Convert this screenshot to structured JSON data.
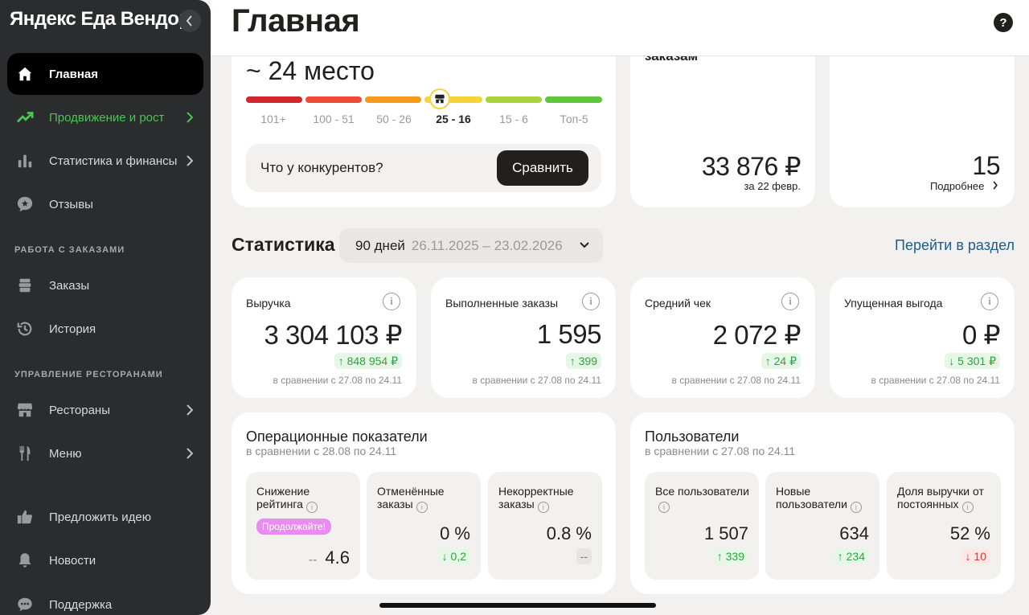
{
  "app": {
    "brand": "Яндекс Еда Вендор"
  },
  "header": {
    "title": "Главная",
    "help": "?"
  },
  "sidebar": {
    "items": [
      {
        "label": "Главная",
        "icon": "home-icon"
      },
      {
        "label": "Продвижение и рост",
        "icon": "trend-icon"
      },
      {
        "label": "Статистика и финансы",
        "icon": "bar-chart-icon"
      },
      {
        "label": "Отзывы",
        "icon": "review-icon"
      }
    ],
    "section_orders": "РАБОТА С ЗАКАЗАМИ",
    "orders_items": [
      {
        "label": "Заказы",
        "icon": "orders-icon"
      },
      {
        "label": "История",
        "icon": "history-icon"
      }
    ],
    "section_restaurants": "УПРАВЛЕНИЕ РЕСТОРАНАМИ",
    "restaurant_items": [
      {
        "label": "Рестораны",
        "icon": "store-icon"
      },
      {
        "label": "Меню",
        "icon": "fork-knife-icon"
      }
    ],
    "bottom_items": [
      {
        "label": "Предложить идею",
        "icon": "thumbs-up-icon"
      },
      {
        "label": "Новости",
        "icon": "bell-icon"
      },
      {
        "label": "Поддержка",
        "icon": "chat-icon"
      }
    ]
  },
  "rating": {
    "place": "~ 24 место",
    "scale": [
      "101+",
      "100 - 51",
      "50 - 26",
      "25 - 16",
      "15 - 6",
      "Топ-5"
    ],
    "current_index": 3,
    "colors": [
      "#d1262d",
      "#ef4a35",
      "#f59a1b",
      "#f5d43a",
      "#a9d33b",
      "#5ec63a"
    ],
    "compare_question": "Что у конкурентов?",
    "compare_button": "Сравнить"
  },
  "orders_card": {
    "title_fragment": "заказам",
    "value": "33 876 ₽",
    "note": "за 22 февр."
  },
  "count_card": {
    "value": "15",
    "link": "Подробнее"
  },
  "stats": {
    "title": "Статистика",
    "period_label": "90 дней",
    "period_range": "26.11.2025 – 23.02.2026",
    "link": "Перейти в раздел",
    "metrics": [
      {
        "title": "Выручка",
        "value": "3 304 103 ₽",
        "delta": "↑ 848 954 ₽",
        "delta_type": "up",
        "note": "в сравнении с 27.08 по 24.11"
      },
      {
        "title": "Выполненные заказы",
        "value": "1 595",
        "delta": "↑ 399",
        "delta_type": "up",
        "note": "в сравнении с 27.08 по 24.11"
      },
      {
        "title": "Средний чек",
        "value": "2 072 ₽",
        "delta": "↑ 24 ₽",
        "delta_type": "up",
        "note": "в сравнении с 27.08 по 24.11"
      },
      {
        "title": "Упущенная выгода",
        "value": "0 ₽",
        "delta": "↓ 5 301 ₽",
        "delta_type": "down",
        "note": "в сравнении с 27.08 по 24.11"
      }
    ]
  },
  "operational": {
    "title": "Операционные показатели",
    "subtitle": "в сравнении с 28.08 по 24.11",
    "cards": [
      {
        "title": "Снижение рейтинга",
        "badge": "Продолжайте!",
        "dash": "--",
        "value": "4.6"
      },
      {
        "title": "Отменённые заказы",
        "value": "0 %",
        "delta": "↓ 0,2"
      },
      {
        "title": "Некорректные заказы",
        "value": "0.8 %",
        "delta": "--"
      }
    ]
  },
  "users": {
    "title": "Пользователи",
    "subtitle": "в сравнении с 27.08 по 24.11",
    "cards": [
      {
        "title": "Все пользователи",
        "value": "1 507",
        "delta": "↑ 339"
      },
      {
        "title": "Новые пользователи",
        "value": "634",
        "delta": "↑ 234"
      },
      {
        "title": "Доля выручки от постоянных",
        "value": "52 %",
        "delta": "↓ 10"
      }
    ]
  }
}
